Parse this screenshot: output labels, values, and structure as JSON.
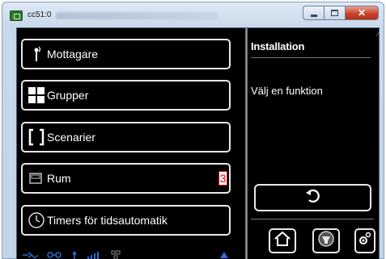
{
  "window": {
    "title": "cc51:0",
    "buttons": {
      "minimize": "minimize",
      "maximize": "maximize",
      "close": "✕"
    }
  },
  "menu": {
    "items": [
      {
        "label": "Mottagare",
        "icon": "antenna-icon"
      },
      {
        "label": "Grupper",
        "icon": "grid-icon"
      },
      {
        "label": "Scenarier",
        "icon": "brackets-icon"
      },
      {
        "label": "Rum",
        "icon": "room-icon",
        "badge": "3"
      },
      {
        "label": "Timers för tidsautomatik",
        "icon": "clock-icon"
      }
    ]
  },
  "status_icons": [
    "connection-icon",
    "link-icon",
    "antenna-signal-icon",
    "signal-bars-icon",
    "network-icon",
    "arrow-up-icon"
  ],
  "panel": {
    "title": "Installation",
    "subtitle": "Välj en funktion",
    "back_icon": "back-icon",
    "bottom_icons": [
      "home-icon",
      "lamp-icon",
      "settings-icon"
    ]
  },
  "colors": {
    "background": "#000000",
    "text": "#ffffff",
    "button_border": "#e8e8e8",
    "badge_red": "#dd1111",
    "status_blue": "#2a6bd6"
  }
}
